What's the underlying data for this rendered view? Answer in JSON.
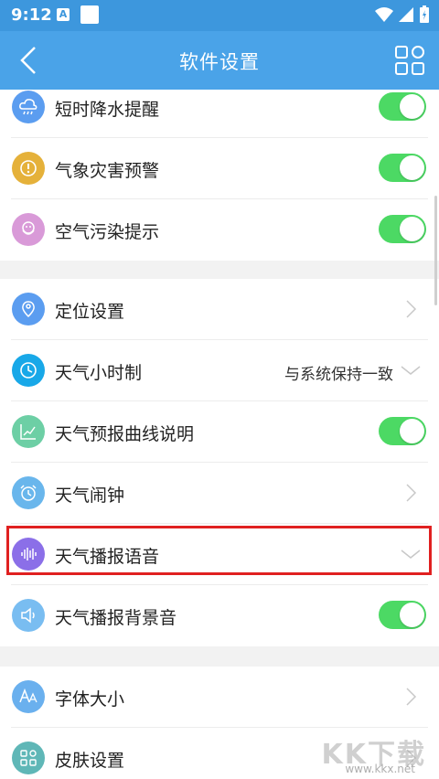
{
  "status_bar": {
    "time": "9:12",
    "notification_letter": "A"
  },
  "header": {
    "title": "软件设置"
  },
  "rows": [
    {
      "label": "短时降水提醒",
      "icon": "cloud-rain-icon",
      "color": "#5b9df0",
      "control": "toggle",
      "on": true
    },
    {
      "label": "气象灾害预警",
      "icon": "warning-icon",
      "color": "#e5b13a",
      "control": "toggle",
      "on": true
    },
    {
      "label": "空气污染提示",
      "icon": "mask-icon",
      "color": "#d99ad8",
      "control": "toggle",
      "on": true
    },
    {
      "label": "定位设置",
      "icon": "location-pin-icon",
      "color": "#5b9df0",
      "control": "chevron-right"
    },
    {
      "label": "天气小时制",
      "icon": "clock-icon",
      "color": "#18a8e8",
      "control": "dropdown",
      "value": "与系统保持一致"
    },
    {
      "label": "天气预报曲线说明",
      "icon": "line-chart-icon",
      "color": "#6dcfa5",
      "control": "toggle",
      "on": true
    },
    {
      "label": "天气闹钟",
      "icon": "alarm-clock-icon",
      "color": "#69b6ec",
      "control": "chevron-right"
    },
    {
      "label": "天气播报语音",
      "icon": "voice-wave-icon",
      "color": "#8b6fe8",
      "control": "dropdown",
      "value": ""
    },
    {
      "label": "天气播报背景音",
      "icon": "speaker-icon",
      "color": "#79bdf1",
      "control": "toggle",
      "on": true
    },
    {
      "label": "字体大小",
      "icon": "font-size-icon",
      "color": "#6ab0ee",
      "control": "chevron-right"
    },
    {
      "label": "皮肤设置",
      "icon": "skin-grid-icon",
      "color": "#5fb7b7",
      "control": "chevron-right"
    }
  ],
  "watermark": {
    "big": "KK下载",
    "small": "www.kkx.net"
  },
  "colors": {
    "accent": "#4aa3e8",
    "toggle_on": "#4cd964",
    "highlight": "#e02020"
  }
}
